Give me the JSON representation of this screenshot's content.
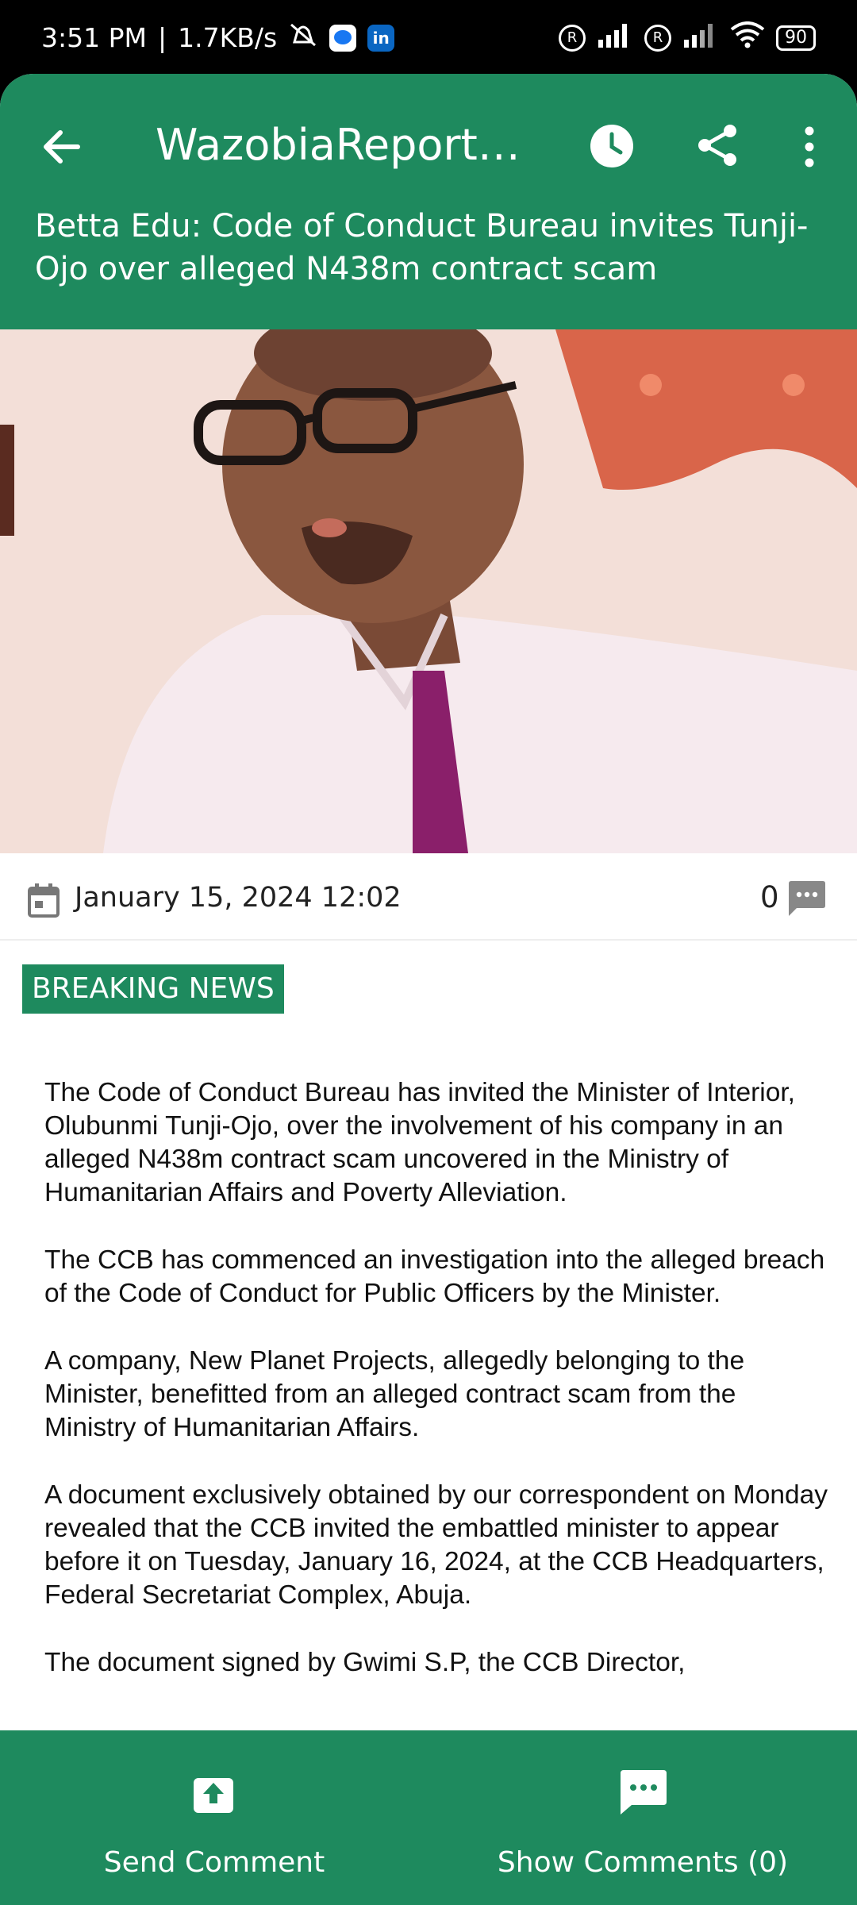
{
  "status_bar": {
    "time": "3:51 PM",
    "net_speed": "1.7KB/s",
    "battery": "90"
  },
  "toolbar": {
    "title": "WazobiaReporters...",
    "headline": "Betta Edu: Code of Conduct Bureau invites Tunji-Ojo over alleged N438m contract scam"
  },
  "meta": {
    "date": "January 15, 2024 12:02",
    "comment_count": "0"
  },
  "category": "BREAKING NEWS",
  "article": {
    "paragraphs": [
      "The Code of Conduct Bureau has invited the Minister of Interior, Olubunmi Tunji-Ojo, over the involvement of his company in an alleged N438m contract scam uncovered in the Ministry of Humanitarian Affairs and Poverty Alleviation.",
      "The CCB has commenced an investigation into the alleged breach of the Code of Conduct for Public Officers by the Minister.",
      "A company, New Planet Projects, allegedly belonging to the Minister, benefitted from an alleged contract scam from the Ministry of Humanitarian Affairs.",
      "A document exclusively obtained by our correspondent on Monday revealed that the CCB invited the embattled minister to appear before it on Tuesday, January 16, 2024, at the CCB Headquarters, Federal Secretariat Complex, Abuja.",
      "The document signed by Gwimi S.P, the CCB Director,"
    ]
  },
  "bottom_bar": {
    "send_label": "Send Comment",
    "show_label": "Show Comments (0)"
  },
  "colors": {
    "primary": "#1e8a5e"
  }
}
